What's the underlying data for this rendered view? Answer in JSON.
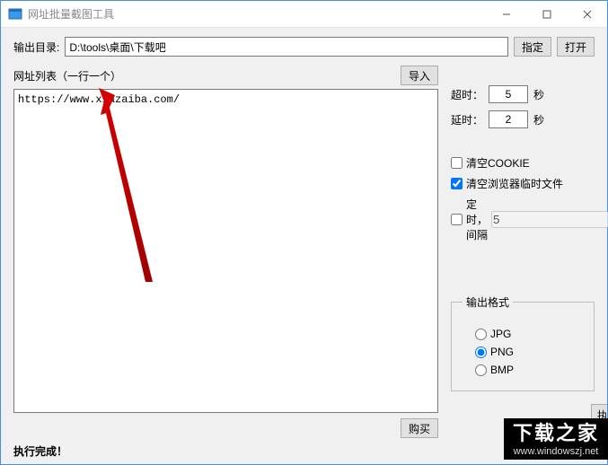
{
  "window": {
    "title": "网址批量截图工具"
  },
  "output": {
    "label": "输出目录:",
    "path": "D:\\tools\\桌面\\下载吧",
    "browse": "指定",
    "open": "打开"
  },
  "urllist": {
    "label": "网址列表（一行一个）",
    "import": "导入",
    "content": "https://www.xiazaiba.com/"
  },
  "buy": {
    "label": "购买"
  },
  "options": {
    "timeout_label": "超时：",
    "timeout_value": "5",
    "delay_label": "延时：",
    "delay_value": "2",
    "seconds": "秒",
    "clear_cookie": "清空COOKIE",
    "clear_cookie_checked": false,
    "clear_temp": "清空浏览器临时文件",
    "clear_temp_checked": true,
    "timer_label": "定时，间隔",
    "timer_value": "5",
    "timer_checked": false
  },
  "format": {
    "legend": "输出格式",
    "jpg": "JPG",
    "png": "PNG",
    "bmp": "BMP",
    "selected": "png"
  },
  "status": {
    "text": "执行完成！"
  },
  "exec_partial": "执",
  "watermark": {
    "big": "下载之家",
    "url": "www.windowszj.net"
  }
}
